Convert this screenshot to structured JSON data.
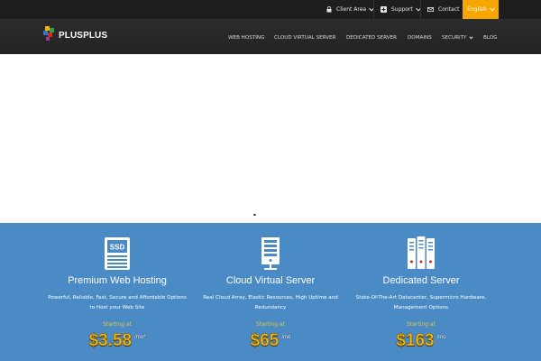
{
  "topbar": {
    "client_area": "Client Area",
    "support": "Support",
    "contact": "Contact",
    "language": "English"
  },
  "brand": {
    "name": "PLUSPLUS"
  },
  "nav": {
    "items": [
      {
        "label": "WEB HOSTING"
      },
      {
        "label": "CLOUD VIRTUAL SERVER"
      },
      {
        "label": "DEDICATED SERVER"
      },
      {
        "label": "DOMAINS"
      },
      {
        "label": "SECURITY"
      },
      {
        "label": "BLOG"
      }
    ]
  },
  "services": [
    {
      "icon": "ssd-icon",
      "icon_label": "SSD",
      "title": "Premium Web Hosting",
      "description": "Powerful, Reliable, Fast, Secure and Affordable Options to Host your Web Site",
      "starting_label": "Starting at",
      "price": "$3.58",
      "unit": "/mo*"
    },
    {
      "icon": "server-rack-icon",
      "title": "Cloud Virtual Server",
      "description": "Real Cloud Array, Elastic Resources, High Uptime and Redundancy",
      "starting_label": "Starting at",
      "price": "$65",
      "unit": "/mo"
    },
    {
      "icon": "datacenter-icon",
      "title": "Dedicated Server",
      "description": "State-Of-The-Art Datacenter, Supermicro Hardware, Management Options",
      "starting_label": "Starting at",
      "price": "$163",
      "unit": "/mo"
    }
  ],
  "colors": {
    "topbar_bg": "#1e1e1e",
    "navbar_bg": "#2a2a2a",
    "language_bg": "#f7a600",
    "services_bg": "#4a8bc6",
    "price_color": "#f3bb1c",
    "starting_color": "#e8c33a"
  }
}
